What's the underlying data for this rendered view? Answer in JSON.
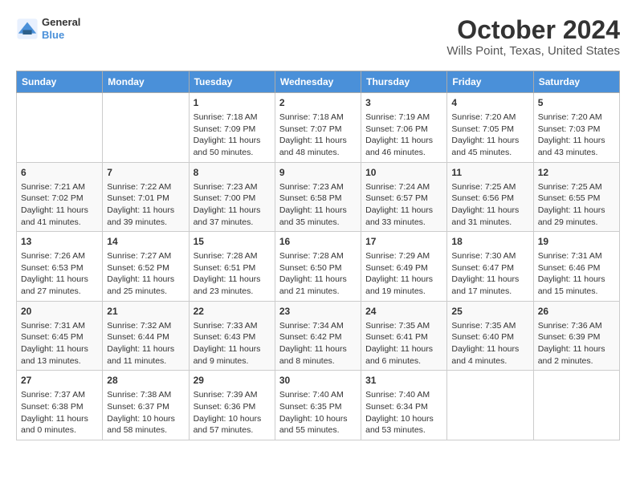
{
  "logo": {
    "line1": "General",
    "line2": "Blue"
  },
  "title": "October 2024",
  "subtitle": "Wills Point, Texas, United States",
  "headers": [
    "Sunday",
    "Monday",
    "Tuesday",
    "Wednesday",
    "Thursday",
    "Friday",
    "Saturday"
  ],
  "weeks": [
    [
      {
        "day": "",
        "data": ""
      },
      {
        "day": "",
        "data": ""
      },
      {
        "day": "1",
        "data": "Sunrise: 7:18 AM\nSunset: 7:09 PM\nDaylight: 11 hours and 50 minutes."
      },
      {
        "day": "2",
        "data": "Sunrise: 7:18 AM\nSunset: 7:07 PM\nDaylight: 11 hours and 48 minutes."
      },
      {
        "day": "3",
        "data": "Sunrise: 7:19 AM\nSunset: 7:06 PM\nDaylight: 11 hours and 46 minutes."
      },
      {
        "day": "4",
        "data": "Sunrise: 7:20 AM\nSunset: 7:05 PM\nDaylight: 11 hours and 45 minutes."
      },
      {
        "day": "5",
        "data": "Sunrise: 7:20 AM\nSunset: 7:03 PM\nDaylight: 11 hours and 43 minutes."
      }
    ],
    [
      {
        "day": "6",
        "data": "Sunrise: 7:21 AM\nSunset: 7:02 PM\nDaylight: 11 hours and 41 minutes."
      },
      {
        "day": "7",
        "data": "Sunrise: 7:22 AM\nSunset: 7:01 PM\nDaylight: 11 hours and 39 minutes."
      },
      {
        "day": "8",
        "data": "Sunrise: 7:23 AM\nSunset: 7:00 PM\nDaylight: 11 hours and 37 minutes."
      },
      {
        "day": "9",
        "data": "Sunrise: 7:23 AM\nSunset: 6:58 PM\nDaylight: 11 hours and 35 minutes."
      },
      {
        "day": "10",
        "data": "Sunrise: 7:24 AM\nSunset: 6:57 PM\nDaylight: 11 hours and 33 minutes."
      },
      {
        "day": "11",
        "data": "Sunrise: 7:25 AM\nSunset: 6:56 PM\nDaylight: 11 hours and 31 minutes."
      },
      {
        "day": "12",
        "data": "Sunrise: 7:25 AM\nSunset: 6:55 PM\nDaylight: 11 hours and 29 minutes."
      }
    ],
    [
      {
        "day": "13",
        "data": "Sunrise: 7:26 AM\nSunset: 6:53 PM\nDaylight: 11 hours and 27 minutes."
      },
      {
        "day": "14",
        "data": "Sunrise: 7:27 AM\nSunset: 6:52 PM\nDaylight: 11 hours and 25 minutes."
      },
      {
        "day": "15",
        "data": "Sunrise: 7:28 AM\nSunset: 6:51 PM\nDaylight: 11 hours and 23 minutes."
      },
      {
        "day": "16",
        "data": "Sunrise: 7:28 AM\nSunset: 6:50 PM\nDaylight: 11 hours and 21 minutes."
      },
      {
        "day": "17",
        "data": "Sunrise: 7:29 AM\nSunset: 6:49 PM\nDaylight: 11 hours and 19 minutes."
      },
      {
        "day": "18",
        "data": "Sunrise: 7:30 AM\nSunset: 6:47 PM\nDaylight: 11 hours and 17 minutes."
      },
      {
        "day": "19",
        "data": "Sunrise: 7:31 AM\nSunset: 6:46 PM\nDaylight: 11 hours and 15 minutes."
      }
    ],
    [
      {
        "day": "20",
        "data": "Sunrise: 7:31 AM\nSunset: 6:45 PM\nDaylight: 11 hours and 13 minutes."
      },
      {
        "day": "21",
        "data": "Sunrise: 7:32 AM\nSunset: 6:44 PM\nDaylight: 11 hours and 11 minutes."
      },
      {
        "day": "22",
        "data": "Sunrise: 7:33 AM\nSunset: 6:43 PM\nDaylight: 11 hours and 9 minutes."
      },
      {
        "day": "23",
        "data": "Sunrise: 7:34 AM\nSunset: 6:42 PM\nDaylight: 11 hours and 8 minutes."
      },
      {
        "day": "24",
        "data": "Sunrise: 7:35 AM\nSunset: 6:41 PM\nDaylight: 11 hours and 6 minutes."
      },
      {
        "day": "25",
        "data": "Sunrise: 7:35 AM\nSunset: 6:40 PM\nDaylight: 11 hours and 4 minutes."
      },
      {
        "day": "26",
        "data": "Sunrise: 7:36 AM\nSunset: 6:39 PM\nDaylight: 11 hours and 2 minutes."
      }
    ],
    [
      {
        "day": "27",
        "data": "Sunrise: 7:37 AM\nSunset: 6:38 PM\nDaylight: 11 hours and 0 minutes."
      },
      {
        "day": "28",
        "data": "Sunrise: 7:38 AM\nSunset: 6:37 PM\nDaylight: 10 hours and 58 minutes."
      },
      {
        "day": "29",
        "data": "Sunrise: 7:39 AM\nSunset: 6:36 PM\nDaylight: 10 hours and 57 minutes."
      },
      {
        "day": "30",
        "data": "Sunrise: 7:40 AM\nSunset: 6:35 PM\nDaylight: 10 hours and 55 minutes."
      },
      {
        "day": "31",
        "data": "Sunrise: 7:40 AM\nSunset: 6:34 PM\nDaylight: 10 hours and 53 minutes."
      },
      {
        "day": "",
        "data": ""
      },
      {
        "day": "",
        "data": ""
      }
    ]
  ]
}
